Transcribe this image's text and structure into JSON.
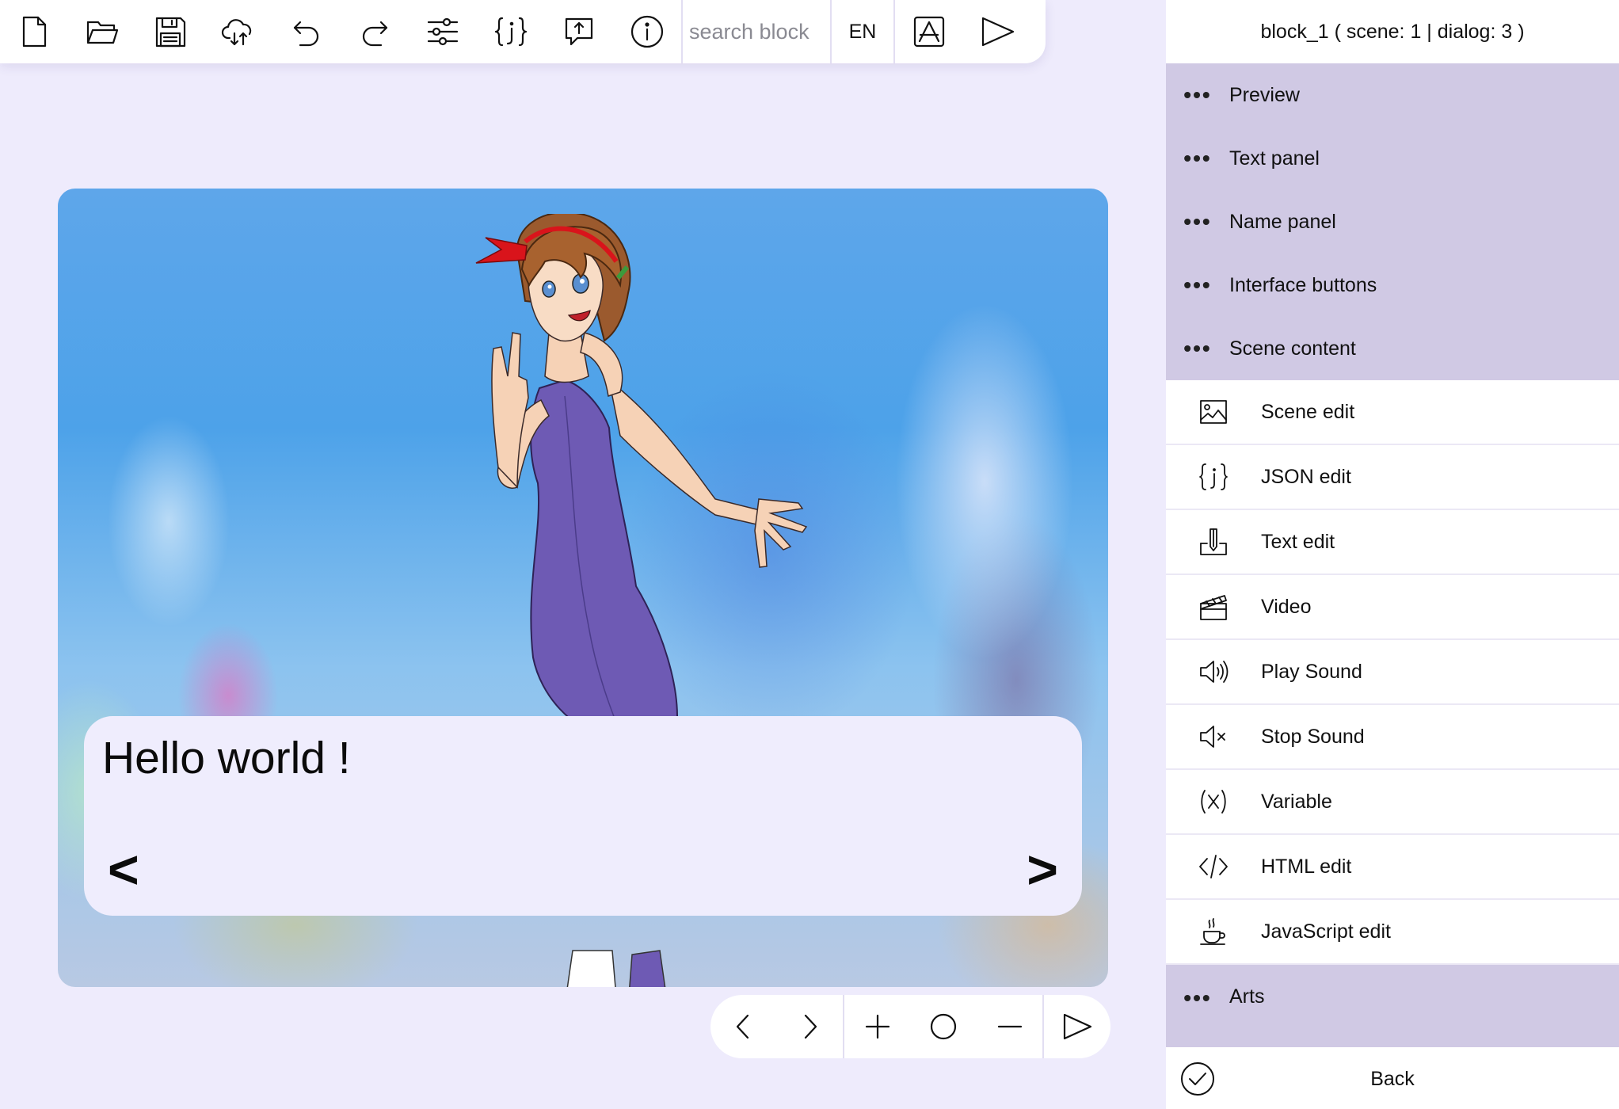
{
  "toolbar": {
    "icons": [
      "new-file-icon",
      "open-folder-icon",
      "save-icon",
      "cloud-sync-icon",
      "undo-icon",
      "redo-icon",
      "settings-sliders-icon",
      "json-icon",
      "share-upload-icon",
      "info-icon",
      "app-store-icon",
      "play-icon"
    ],
    "search_placeholder": "search block",
    "language": "EN"
  },
  "stage": {
    "dialog_text": "Hello world !",
    "prev_symbol": "<",
    "next_symbol": ">"
  },
  "controls": {
    "icons": [
      "chevron-left-icon",
      "chevron-right-icon",
      "plus-icon",
      "circle-icon",
      "minus-icon",
      "play-icon"
    ]
  },
  "panel": {
    "header": "block_1 ( scene: 1 | dialog: 3 )",
    "groups": [
      {
        "dots": "•••",
        "label": "Preview"
      },
      {
        "dots": "•••",
        "label": "Text panel"
      },
      {
        "dots": "•••",
        "label": "Name panel"
      },
      {
        "dots": "•••",
        "label": "Interface buttons"
      },
      {
        "dots": "•••",
        "label": "Scene content"
      }
    ],
    "blocks": [
      {
        "label": "Scene edit",
        "icon": "image-icon"
      },
      {
        "label": "JSON edit",
        "icon": "json-icon"
      },
      {
        "label": "Text edit",
        "icon": "text-edit-icon"
      },
      {
        "label": "Video",
        "icon": "clapperboard-icon"
      },
      {
        "label": "Play Sound",
        "icon": "speaker-on-icon"
      },
      {
        "label": "Stop Sound",
        "icon": "speaker-mute-icon"
      },
      {
        "label": "Variable",
        "icon": "variable-icon"
      },
      {
        "label": "HTML edit",
        "icon": "code-icon"
      },
      {
        "label": "JavaScript edit",
        "icon": "coffee-cup-icon"
      }
    ],
    "arts": {
      "dots": "•••",
      "label": "Arts"
    },
    "back_label": "Back"
  },
  "colors": {
    "background": "#eeebfc",
    "group_bg": "#d0c9e4",
    "dialog_bg": "#efedfd",
    "dress": "#6e5ab4",
    "hair": "#9b5a2e",
    "ribbon": "#d9141b"
  }
}
